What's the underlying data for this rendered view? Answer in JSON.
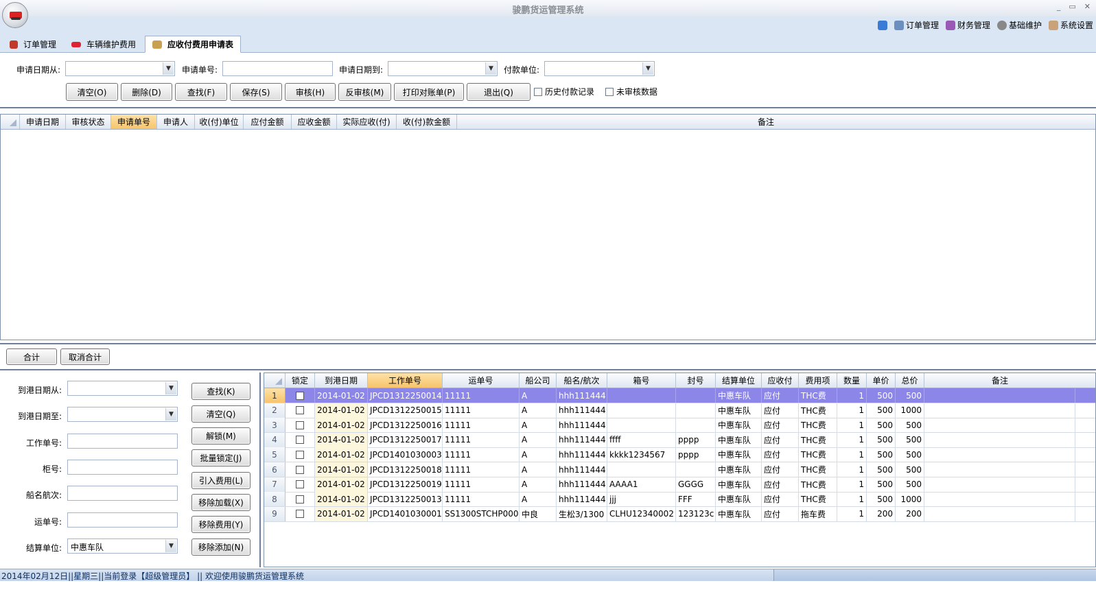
{
  "window": {
    "title": "骏鹏货运管理系统",
    "controls": [
      "_",
      "▭",
      "✕"
    ]
  },
  "topmenu": [
    {
      "label": "订单管理",
      "icon": "order-icon"
    },
    {
      "label": "财务管理",
      "icon": "finance-icon"
    },
    {
      "label": "基础维护",
      "icon": "gear-icon"
    },
    {
      "label": "系统设置",
      "icon": "settings-icon"
    }
  ],
  "tabs": [
    {
      "label": "订单管理",
      "icon": "order-tab-icon"
    },
    {
      "label": "车辆维护费用",
      "icon": "car-icon"
    },
    {
      "label": "应收付费用申请表",
      "icon": "folder-icon",
      "active": true
    }
  ],
  "search": {
    "date_from_label": "申请日期从:",
    "app_no_label": "申请单号:",
    "date_to_label": "申请日期到:",
    "payer_label": "付款单位:",
    "buttons": [
      "清空(O)",
      "删除(D)",
      "查找(F)",
      "保存(S)",
      "审核(H)",
      "反审核(M)",
      "打印对账单(P)",
      "退出(Q)"
    ],
    "history_label": "历史付款记录",
    "unreviewed_label": "未审核数据"
  },
  "grid1": {
    "headers": [
      "申请日期",
      "审核状态",
      "申请单号",
      "申请人",
      "收(付)单位",
      "应付金额",
      "应收金额",
      "实际应收(付)",
      "收(付)款金额",
      "备注"
    ]
  },
  "mid": {
    "sum_label": "合计",
    "cancel_sum_label": "取消合计"
  },
  "filter": {
    "arrive_from_label": "到港日期从:",
    "arrive_to_label": "到港日期至:",
    "job_no_label": "工作单号:",
    "container_label": "柜号:",
    "vessel_label": "船名航次:",
    "waybill_label": "运单号:",
    "settle_label": "结算单位:",
    "settle_value": "中惠车队",
    "buttons": [
      "查找(K)",
      "清空(Q)",
      "解锁(M)",
      "批量锁定(J)",
      "引入费用(L)",
      "移除加载(X)",
      "移除费用(Y)",
      "移除添加(N)"
    ]
  },
  "grid2": {
    "headers": [
      "锁定",
      "到港日期",
      "工作单号",
      "运单号",
      "船公司",
      "船名/航次",
      "箱号",
      "封号",
      "结算单位",
      "应收付",
      "费用项",
      "数量",
      "单价",
      "总价",
      "备注"
    ],
    "rows": [
      [
        "1",
        "2014-01-02",
        "JPCD1312250014",
        "11111",
        "A",
        "hhh111444",
        "",
        "",
        "中惠车队",
        "应付",
        "THC费",
        "1",
        "500",
        "500",
        ""
      ],
      [
        "2",
        "2014-01-02",
        "JPCD1312250015",
        "11111",
        "A",
        "hhh111444",
        "",
        "",
        "中惠车队",
        "应付",
        "THC费",
        "1",
        "500",
        "1000",
        ""
      ],
      [
        "3",
        "2014-01-02",
        "JPCD1312250016",
        "11111",
        "A",
        "hhh111444",
        "",
        "",
        "中惠车队",
        "应付",
        "THC费",
        "1",
        "500",
        "500",
        ""
      ],
      [
        "4",
        "2014-01-02",
        "JPCD1312250017",
        "11111",
        "A",
        "hhh111444",
        "ffff",
        "pppp",
        "中惠车队",
        "应付",
        "THC费",
        "1",
        "500",
        "500",
        ""
      ],
      [
        "5",
        "2014-01-02",
        "JPCD1401030003",
        "11111",
        "A",
        "hhh111444",
        "kkkk1234567",
        "pppp",
        "中惠车队",
        "应付",
        "THC费",
        "1",
        "500",
        "500",
        ""
      ],
      [
        "6",
        "2014-01-02",
        "JPCD1312250018",
        "11111",
        "A",
        "hhh111444",
        "",
        "",
        "中惠车队",
        "应付",
        "THC费",
        "1",
        "500",
        "500",
        ""
      ],
      [
        "7",
        "2014-01-02",
        "JPCD1312250019",
        "11111",
        "A",
        "hhh111444",
        "AAAA1",
        "GGGG",
        "中惠车队",
        "应付",
        "THC费",
        "1",
        "500",
        "500",
        ""
      ],
      [
        "8",
        "2014-01-02",
        "JPCD1312250013",
        "11111",
        "A",
        "hhh111444",
        "jjj",
        "FFF",
        "中惠车队",
        "应付",
        "THC费",
        "1",
        "500",
        "1000",
        ""
      ],
      [
        "9",
        "2014-01-02",
        "JPCD1401030001",
        "SS1300STCHP000",
        "中良",
        "生松3/1300",
        "CLHU12340002",
        "123123c",
        "中惠车队",
        "应付",
        "拖车费",
        "1",
        "200",
        "200",
        ""
      ]
    ]
  },
  "status": "2014年02月12日||星期三||当前登录【超级管理员】 || 欢迎使用骏鹏货运管理系统"
}
